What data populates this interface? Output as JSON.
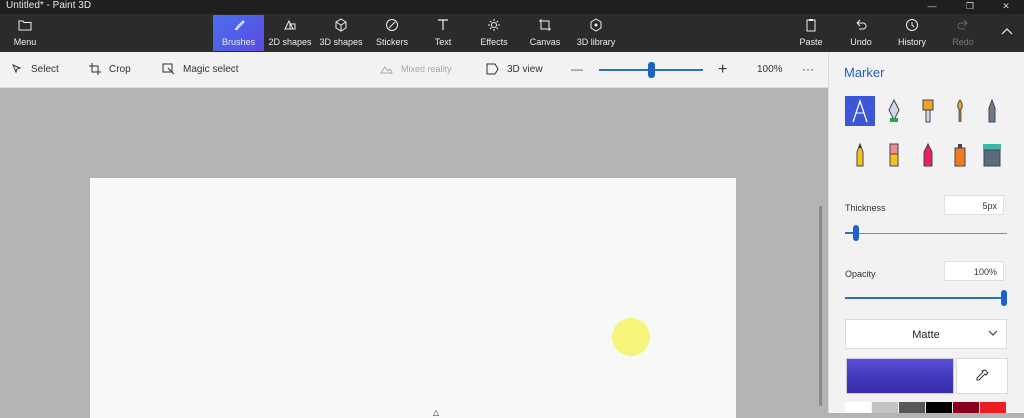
{
  "window": {
    "title": "Untitled* - Paint 3D",
    "controls": [
      "minimize",
      "restore",
      "close"
    ]
  },
  "ribbon": {
    "menu": {
      "label": "Menu",
      "icon": "folder-icon"
    },
    "tools": [
      {
        "label": "Brushes",
        "icon": "brush-icon",
        "active": true
      },
      {
        "label": "2D shapes",
        "icon": "2d-shapes-icon"
      },
      {
        "label": "3D shapes",
        "icon": "3d-shapes-icon"
      },
      {
        "label": "Stickers",
        "icon": "stickers-icon"
      },
      {
        "label": "Text",
        "icon": "text-icon"
      },
      {
        "label": "Effects",
        "icon": "effects-icon"
      },
      {
        "label": "Canvas",
        "icon": "canvas-icon"
      },
      {
        "label": "3D library",
        "icon": "3d-library-icon"
      }
    ],
    "actions": [
      {
        "label": "Paste",
        "icon": "paste-icon"
      },
      {
        "label": "Undo",
        "icon": "undo-icon"
      },
      {
        "label": "History",
        "icon": "history-icon"
      },
      {
        "label": "Redo",
        "icon": "redo-icon",
        "disabled": true
      }
    ]
  },
  "toolbar": {
    "select_label": "Select",
    "crop_label": "Crop",
    "magic_select_label": "Magic select",
    "mixed_reality_label": "Mixed reality",
    "view_3d_label": "3D view",
    "zoom_out": "—",
    "zoom_in": "+",
    "zoom_level": "100%",
    "zoom_fraction": 0.5,
    "more": "···"
  },
  "panel": {
    "title": "Marker",
    "brushes": [
      "marker",
      "calligraphy-pen",
      "oil-brush",
      "watercolor",
      "pixel-pen",
      "pencil",
      "eraser",
      "crayon",
      "spray-can",
      "fill"
    ],
    "thickness_label": "Thickness",
    "thickness_value": "5px",
    "thickness_fraction": 0.05,
    "opacity_label": "Opacity",
    "opacity_value": "100%",
    "opacity_fraction": 1.0,
    "finish_value": "Matte",
    "current_color": "#4a40c9",
    "palette": [
      "#ffffff",
      "#c3c3c3",
      "#585858",
      "#000000",
      "#88001b",
      "#ec1c24"
    ]
  },
  "canvas": {
    "background": "#f7f9f6",
    "dot_color": "#f4f57a"
  }
}
